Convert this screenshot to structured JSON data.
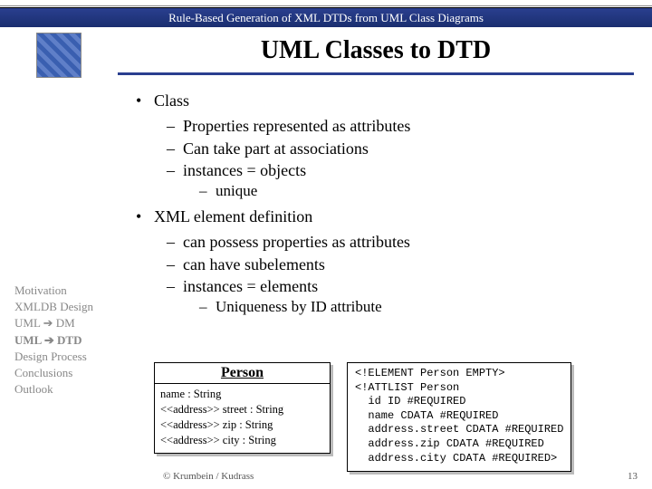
{
  "header": "Rule-Based Generation of XML DTDs from UML Class Diagrams",
  "title": "UML Classes to DTD",
  "bullets": {
    "class_label": "Class",
    "class_items": [
      "Properties represented as attributes",
      "Can take part at associations",
      "instances = objects"
    ],
    "class_sub": "unique",
    "xml_label": "XML element definition",
    "xml_items": [
      "can possess properties as attributes",
      "can have subelements",
      "instances = elements"
    ],
    "xml_sub": "Uniqueness by ID attribute"
  },
  "sidebar": {
    "items": [
      "Motivation",
      "XMLDB Design",
      "UML ➔ DM",
      "UML ➔ DTD",
      "Design Process",
      "Conclusions",
      "Outlook"
    ]
  },
  "uml": {
    "head": "Person",
    "lines": [
      "name : String",
      "<<address>> street : String",
      "<<address>> zip : String",
      "<<address>> city : String"
    ]
  },
  "code": "<!ELEMENT Person EMPTY>\n<!ATTLIST Person\n  id ID #REQUIRED\n  name CDATA #REQUIRED\n  address.street CDATA #REQUIRED\n  address.zip CDATA #REQUIRED\n  address.city CDATA #REQUIRED>",
  "footer": {
    "left": "© Krumbein / Kudrass",
    "right": "13"
  }
}
